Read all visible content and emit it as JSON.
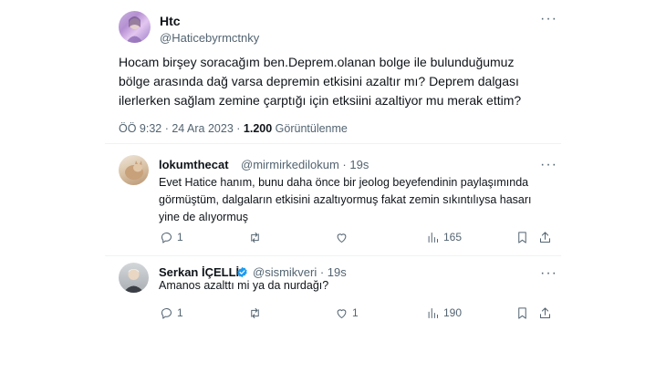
{
  "main_tweet": {
    "author_name": "Htc",
    "author_handle": "@Haticebyrmctnky",
    "text": "Hocam birşey soracağım ben.Deprem.olanan bolge ile bulunduğumuz bölge arasında dağ varsa depremin etkisini azaltır mı? Deprem dalgası ilerlerken sağlam zemine çarptığı için etksiini azaltiyor mu merak ettim?",
    "time": "ÖÖ 9:32 · 24 Ara 2023 · ",
    "views_count": "1.200",
    "views_label": "Görüntülenme"
  },
  "replies": [
    {
      "author_name": "lokumthecat",
      "author_handle": "@mirmirkedilokum · 19s",
      "text": "Evet Hatice hanım, bunu daha önce bir jeolog beyefendinin paylaşımında görmüştüm, dalgaların etkisini azaltıyormuş fakat zemin sıkıntılıysa hasarı yine de alıyormuş",
      "reply_count": "1",
      "retweet_count": "",
      "like_count": "",
      "view_count": "165"
    },
    {
      "author_name": "Serkan İÇELLİ",
      "author_handle": "@sismikveri · 19s",
      "text": "Amanos azalttı mi ya da nurdağı?",
      "reply_count": "1",
      "retweet_count": "",
      "like_count": "1",
      "view_count": "190"
    }
  ],
  "colors": {
    "accent": "#1d9bf0",
    "muted": "#536471",
    "text": "#0f1419",
    "border": "#eff3f4"
  },
  "icons": [
    "more-icon",
    "reply-icon",
    "retweet-icon",
    "like-icon",
    "views-icon",
    "bookmark-icon",
    "share-icon",
    "verified-icon"
  ]
}
